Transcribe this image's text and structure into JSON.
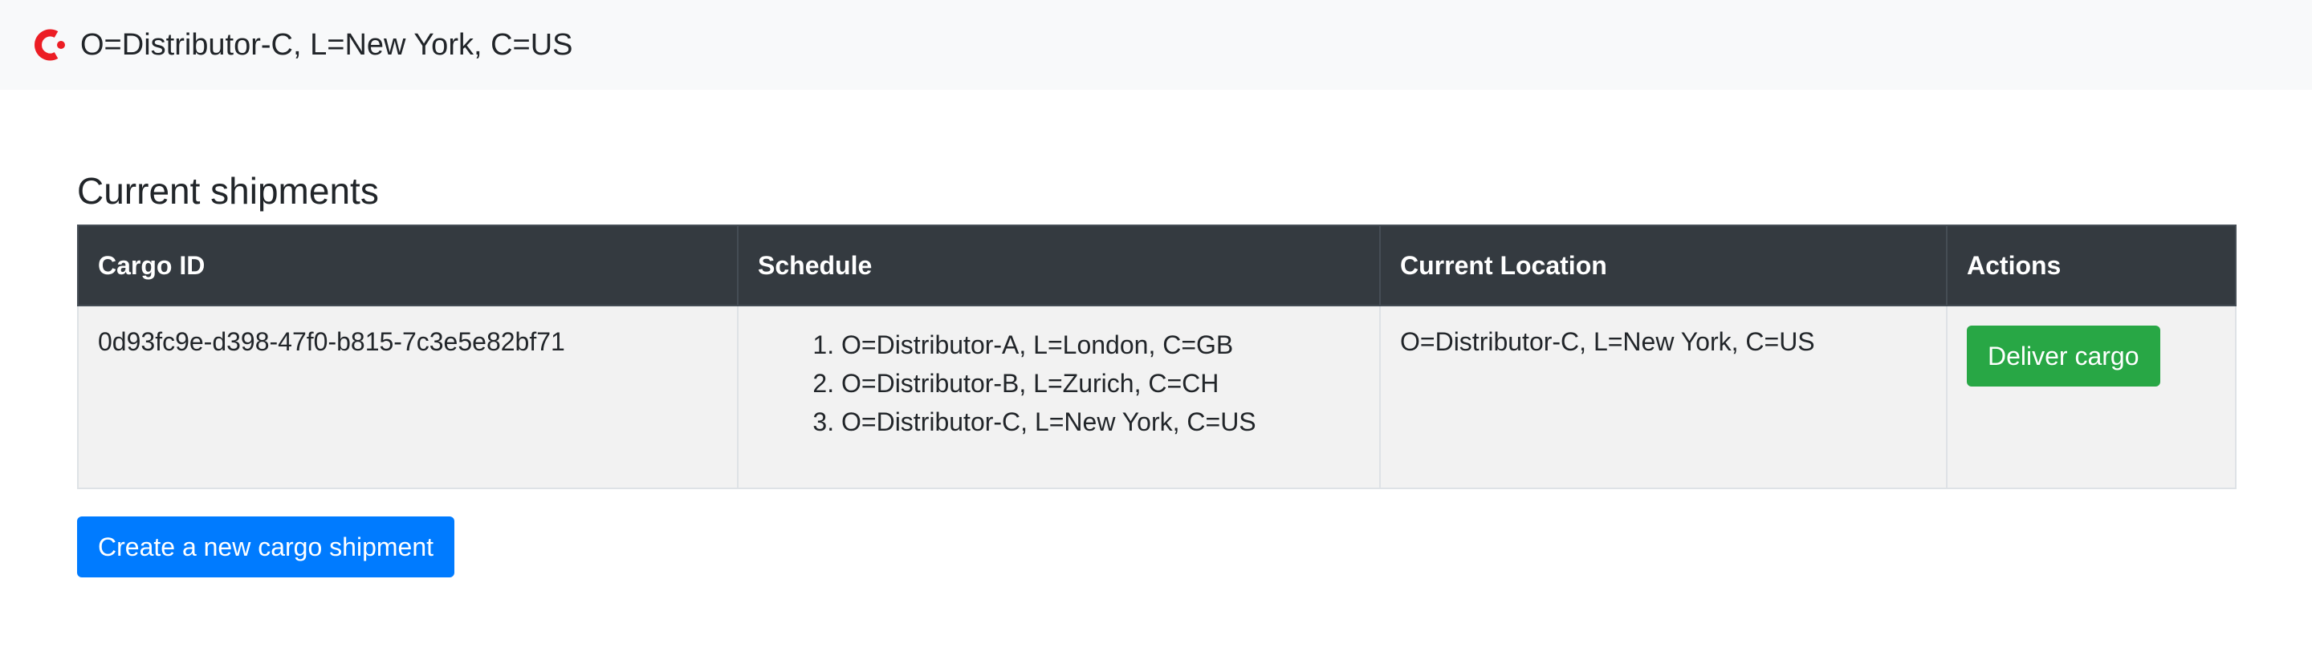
{
  "header": {
    "title": "O=Distributor-C, L=New York, C=US",
    "logo_icon": "corda-logo-icon",
    "logo_color": "#ec1d24"
  },
  "main": {
    "title": "Current shipments",
    "table": {
      "columns": [
        "Cargo ID",
        "Schedule",
        "Current Location",
        "Actions"
      ],
      "rows": [
        {
          "cargo_id": "0d93fc9e-d398-47f0-b815-7c3e5e82bf71",
          "schedule": [
            "O=Distributor-A, L=London, C=GB",
            "O=Distributor-B, L=Zurich, C=CH",
            "O=Distributor-C, L=New York, C=US"
          ],
          "current_location": "O=Distributor-C, L=New York, C=US",
          "action_label": "Deliver cargo"
        }
      ]
    },
    "create_button_label": "Create a new cargo shipment"
  },
  "colors": {
    "header_bg": "#f8f9fa",
    "table_head_bg": "#343a40",
    "row_bg": "#f2f2f2",
    "success": "#28a745",
    "primary": "#007bff"
  }
}
